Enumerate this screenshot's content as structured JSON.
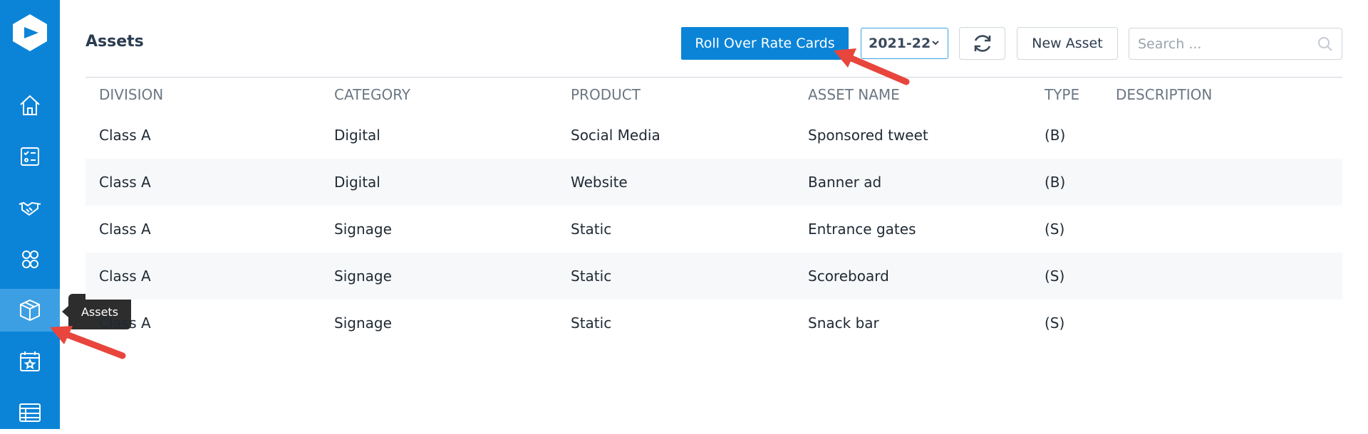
{
  "sidebar": {
    "items": [
      {
        "name": "home"
      },
      {
        "name": "tasks"
      },
      {
        "name": "deals"
      },
      {
        "name": "contacts"
      },
      {
        "name": "assets",
        "active": true
      },
      {
        "name": "events"
      },
      {
        "name": "reports"
      }
    ],
    "tooltip": "Assets"
  },
  "header": {
    "title": "Assets",
    "rollover_label": "Roll Over Rate Cards",
    "year_value": "2021-22",
    "new_asset_label": "New Asset",
    "search_placeholder": "Search ..."
  },
  "table": {
    "columns": [
      "DIVISION",
      "CATEGORY",
      "PRODUCT",
      "ASSET NAME",
      "TYPE",
      "DESCRIPTION"
    ],
    "rows": [
      [
        "Class A",
        "Digital",
        "Social Media",
        "Sponsored tweet",
        "(B)",
        ""
      ],
      [
        "Class A",
        "Digital",
        "Website",
        "Banner ad",
        "(B)",
        ""
      ],
      [
        "Class A",
        "Signage",
        "Static",
        "Entrance gates",
        "(S)",
        ""
      ],
      [
        "Class A",
        "Signage",
        "Static",
        "Scoreboard",
        "(S)",
        ""
      ],
      [
        "Class A",
        "Signage",
        "Static",
        "Snack bar",
        "(S)",
        ""
      ]
    ]
  },
  "colors": {
    "brand": "#0b84d8",
    "annotation_arrow": "#e8453c"
  }
}
